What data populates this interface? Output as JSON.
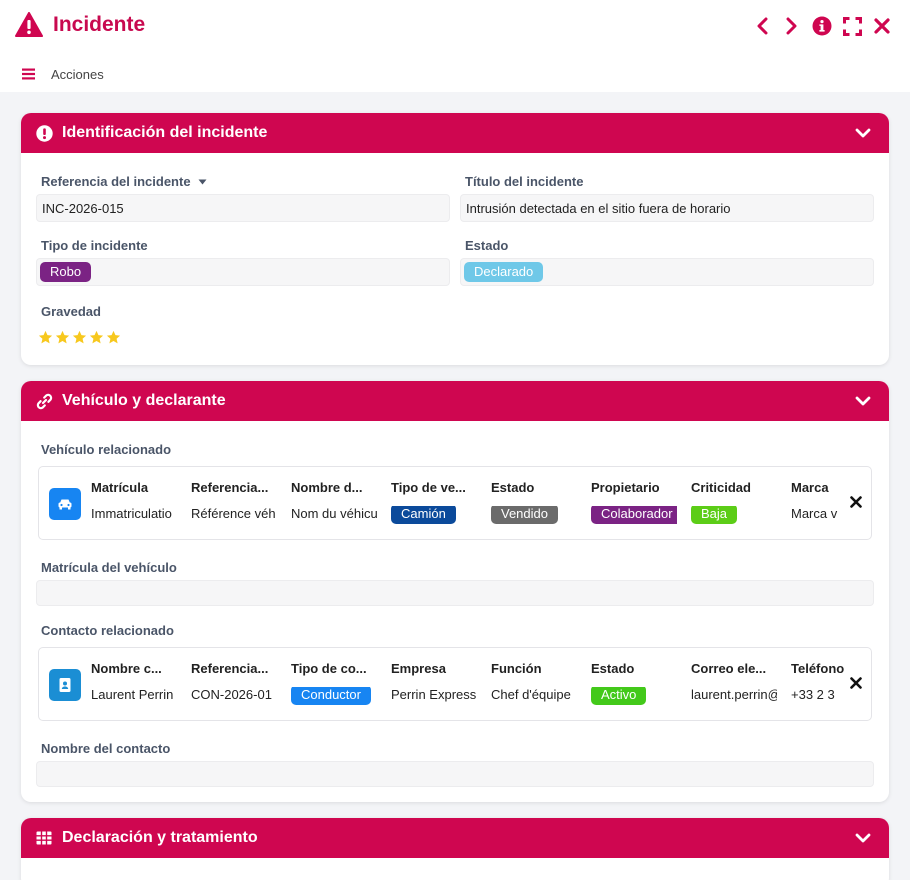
{
  "window": {
    "title": "Incidente",
    "actions_label": "Acciones"
  },
  "sections": {
    "identificacion": {
      "title": "Identificación del incidente",
      "referencia_label": "Referencia del incidente",
      "referencia_value": "INC-2026-015",
      "titulo_label": "Título del incidente",
      "titulo_value": "Intrusión detectada en el sitio fuera de horario",
      "tipo_label": "Tipo de incidente",
      "tipo_value": "Robo",
      "estado_label": "Estado",
      "estado_value": "Declarado",
      "gravedad_label": "Gravedad",
      "gravedad_rating": 5,
      "gravedad_max": 5
    },
    "vehiculo": {
      "title": "Vehículo y declarante",
      "vehiculo_rel_label": "Vehículo relacionado",
      "vehiculo_columns": [
        "Matrícula",
        "Referencia...",
        "Nombre d...",
        "Tipo de ve...",
        "Estado",
        "Propietario",
        "Criticidad",
        "Marca"
      ],
      "vehiculo_values": [
        "Immatriculatio",
        "Référence véh",
        "Nom du véhicu",
        "Camión",
        "Vendido",
        "Colaborador",
        "Baja",
        "Marca v"
      ],
      "matricula_label": "Matrícula del vehículo",
      "matricula_value": "",
      "contacto_rel_label": "Contacto relacionado",
      "contacto_columns": [
        "Nombre c...",
        "Referencia...",
        "Tipo de co...",
        "Empresa",
        "Función",
        "Estado",
        "Correo ele...",
        "Teléfono"
      ],
      "contacto_values": [
        "Laurent Perrin",
        "CON-2026-01",
        "Conductor",
        "Perrin Express",
        "Chef d'équipe",
        "Activo",
        "laurent.perrin@",
        "+33 2 3"
      ],
      "contacto_nombre_label": "Nombre del contacto",
      "contacto_nombre_value": ""
    },
    "declaracion": {
      "title": "Declaración y tratamiento"
    }
  },
  "colors": {
    "brand": "#cf0650",
    "tipo_robo": "#7b2384",
    "estado_declarado": "#6fc8e8",
    "camion": "#0b4a9b",
    "vendido": "#6b6b6b",
    "colaborador": "#7b2384",
    "baja": "#5ccd17",
    "conductor": "#1785f2",
    "activo": "#43c91a",
    "vehicle_badge": "#1785f2",
    "contact_badge": "#1b8ed4",
    "star": "#f7c81e"
  }
}
